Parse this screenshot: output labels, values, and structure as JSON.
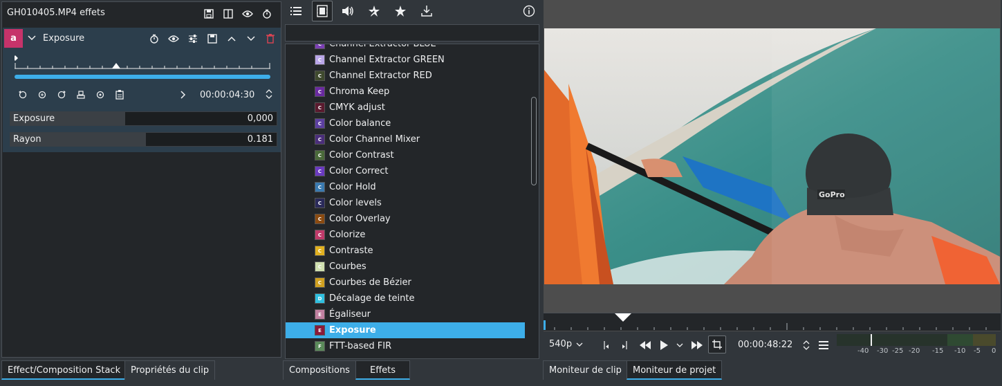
{
  "effect_stack": {
    "title": "GH010405.MP4 effets",
    "effect_badge": "a",
    "effect_name": "Exposure",
    "timecode": "00:00:04:30",
    "params": [
      {
        "label": "Exposure",
        "value": "0,000",
        "fraction": 0.43
      },
      {
        "label": "Rayon",
        "value": "0.181",
        "fraction": 0.51
      }
    ]
  },
  "effects_list": {
    "items": [
      {
        "badge": "C",
        "name": "Channel Extractor BLUE",
        "color": "#7b3fb4"
      },
      {
        "badge": "C",
        "name": "Channel Extractor GREEN",
        "color": "#b9a6e8"
      },
      {
        "badge": "C",
        "name": "Channel Extractor RED",
        "color": "#3f4a2e"
      },
      {
        "badge": "C",
        "name": "Chroma Keep",
        "color": "#6a2aa0"
      },
      {
        "badge": "C",
        "name": "CMYK adjust",
        "color": "#5a1a2e"
      },
      {
        "badge": "C",
        "name": "Color balance",
        "color": "#5c3fa0"
      },
      {
        "badge": "C",
        "name": "Color Channel Mixer",
        "color": "#4a2e7a"
      },
      {
        "badge": "C",
        "name": "Color Contrast",
        "color": "#4a6a3a"
      },
      {
        "badge": "C",
        "name": "Color Correct",
        "color": "#6a3ac0"
      },
      {
        "badge": "C",
        "name": "Color Hold",
        "color": "#3a7ab0"
      },
      {
        "badge": "C",
        "name": "Color levels",
        "color": "#2a2a5a"
      },
      {
        "badge": "C",
        "name": "Color Overlay",
        "color": "#8a4a10"
      },
      {
        "badge": "C",
        "name": "Colorize",
        "color": "#c03a6a"
      },
      {
        "badge": "C",
        "name": "Contraste",
        "color": "#e0b020"
      },
      {
        "badge": "C",
        "name": "Courbes",
        "color": "#d0e0b0"
      },
      {
        "badge": "C",
        "name": "Courbes de Bézier",
        "color": "#d0a020"
      },
      {
        "badge": "D",
        "name": "Décalage de teinte",
        "color": "#30c0e0"
      },
      {
        "badge": "E",
        "name": "Égaliseur",
        "color": "#c080a0"
      },
      {
        "badge": "E",
        "name": "Exposure",
        "color": "#8a1a3a",
        "selected": true
      },
      {
        "badge": "F",
        "name": "FTT-based FIR",
        "color": "#5a8a5a"
      }
    ],
    "search_placeholder": ""
  },
  "monitor": {
    "resolution": "540p",
    "timecode": "00:00:48:22",
    "meter_labels": [
      "-40",
      "-30",
      "-25",
      "-20",
      "-15",
      "-10",
      "-5",
      "0"
    ],
    "watermark": "GoPro"
  },
  "tabs": {
    "left": [
      "Effect/Composition Stack",
      "Propriétés du clip"
    ],
    "middle": [
      "Compositions",
      "Effets"
    ],
    "right": [
      "Moniteur de clip",
      "Moniteur de projet"
    ]
  }
}
